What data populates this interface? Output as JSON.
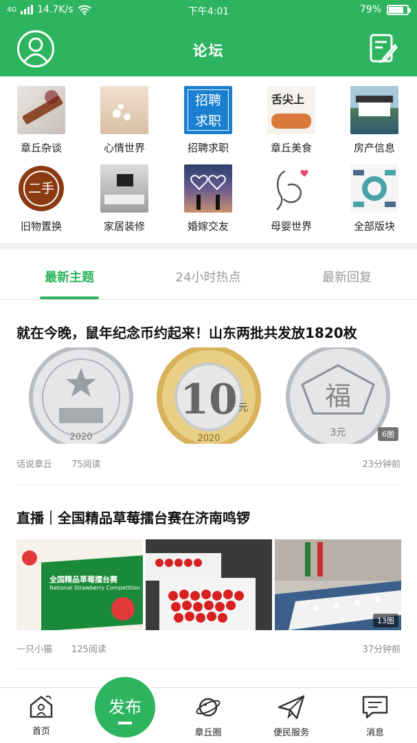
{
  "status_bar": {
    "network": "4G",
    "speed": "14.7K/s",
    "time": "下午4:01",
    "battery": "79%",
    "battery_level": 0.79
  },
  "header": {
    "title": "论坛"
  },
  "categories": [
    {
      "label": "章丘杂谈",
      "icon": "guzheng-photo"
    },
    {
      "label": "心情世界",
      "icon": "flowers-photo"
    },
    {
      "label": "招聘求职",
      "icon": "recruit-sign",
      "sign_line1": "招聘",
      "sign_line2": "求职"
    },
    {
      "label": "章丘美食",
      "icon": "food-photo",
      "sign_text": "舌尖上"
    },
    {
      "label": "房产信息",
      "icon": "house-photo"
    },
    {
      "label": "旧物置换",
      "icon": "second-hand-badge",
      "sign_text": "二手"
    },
    {
      "label": "家居装修",
      "icon": "living-room-photo"
    },
    {
      "label": "婚嫁交友",
      "icon": "couple-hearts-photo"
    },
    {
      "label": "母婴世界",
      "icon": "mother-baby-icon"
    },
    {
      "label": "全部版块",
      "icon": "all-boards-icon"
    }
  ],
  "tabs": [
    {
      "label": "最新主题",
      "active": true
    },
    {
      "label": "24小时热点",
      "active": false
    },
    {
      "label": "最新回复",
      "active": false
    }
  ],
  "posts": [
    {
      "title": "就在今晚，鼠年纪念币约起来！山东两批共发放1820枚",
      "author": "话说章丘",
      "reads": "75阅读",
      "time": "23分钟前",
      "image_count": "6图",
      "coin_2_value": "10",
      "coin_2_unit": "元",
      "coin_2_year": "2020",
      "coin_1_year": "2020",
      "coin_3_char": "福",
      "coin_3_value": "3元"
    },
    {
      "title": "直播｜全国精品草莓擂台赛在济南鸣锣",
      "author": "一只小猫",
      "reads": "125阅读",
      "time": "37分钟前",
      "image_count": "13图",
      "banner_text": "全国精品草莓擂台赛",
      "banner_subtext": "National Strawberry Competition"
    }
  ],
  "bottom_nav": {
    "publish_label": "发布",
    "items": [
      {
        "label": "首页",
        "icon": "home-icon"
      },
      {
        "label": "章丘圈",
        "icon": "planet-icon"
      },
      {
        "label": "便民服务",
        "icon": "paper-plane-icon"
      },
      {
        "label": "消息",
        "icon": "message-icon"
      }
    ]
  },
  "colors": {
    "primary": "#2db45f",
    "muted": "#999999"
  }
}
